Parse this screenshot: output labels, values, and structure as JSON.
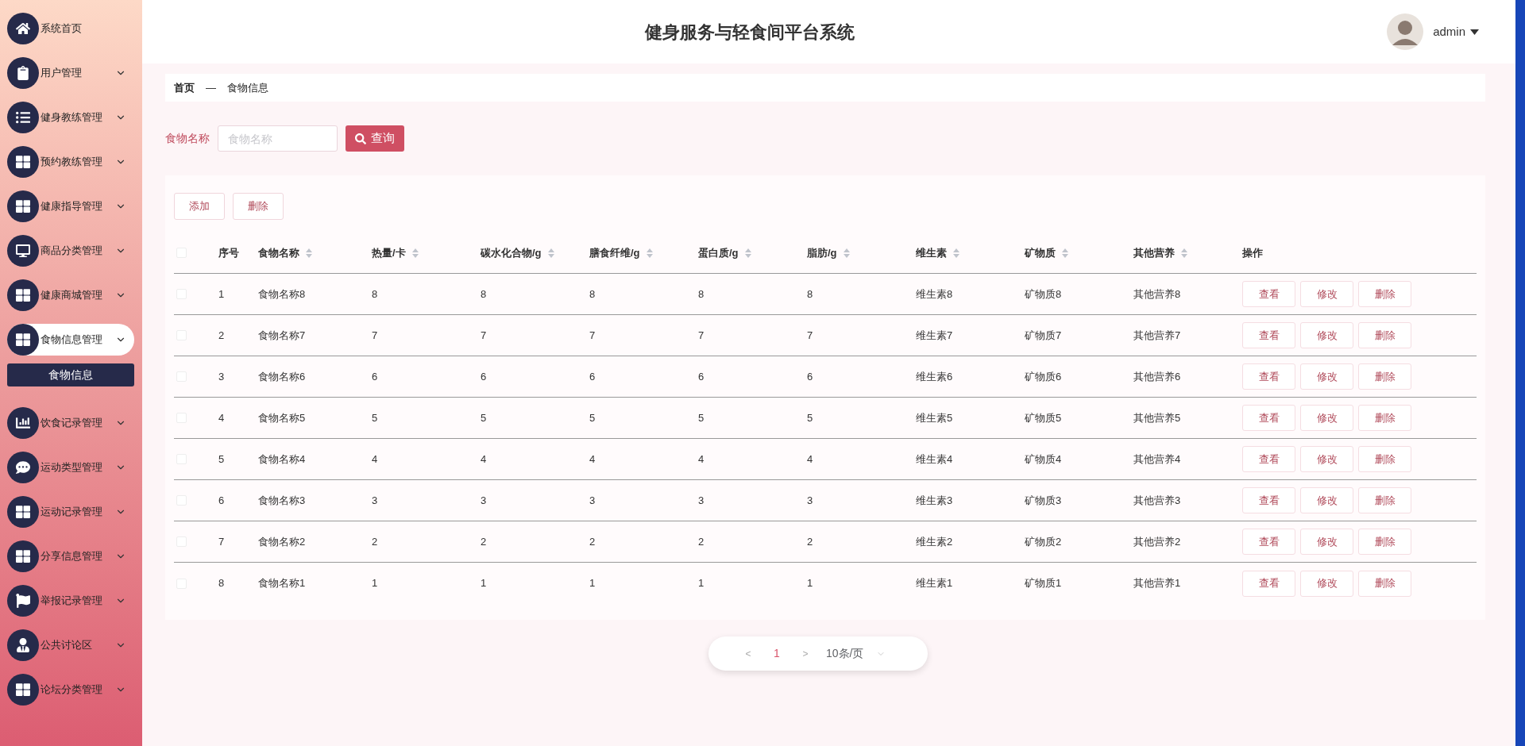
{
  "sidebar": {
    "items": [
      {
        "label": "系统首页",
        "kind": "home",
        "expandable": false,
        "selected": false
      },
      {
        "label": "用户管理",
        "kind": "clipboard",
        "expandable": true,
        "selected": false
      },
      {
        "label": "健身教练管理",
        "kind": "list",
        "expandable": true,
        "selected": false
      },
      {
        "label": "预约教练管理",
        "kind": "grid",
        "expandable": true,
        "selected": false
      },
      {
        "label": "健康指导管理",
        "kind": "grid",
        "expandable": true,
        "selected": false
      },
      {
        "label": "商品分类管理",
        "kind": "monitor",
        "expandable": true,
        "selected": false
      },
      {
        "label": "健康商城管理",
        "kind": "grid",
        "expandable": true,
        "selected": false
      },
      {
        "label": "食物信息管理",
        "kind": "grid",
        "expandable": true,
        "selected": true,
        "children": [
          {
            "label": "食物信息",
            "selected": true
          }
        ]
      },
      {
        "label": "饮食记录管理",
        "kind": "chart",
        "expandable": true,
        "selected": false
      },
      {
        "label": "运动类型管理",
        "kind": "chat",
        "expandable": true,
        "selected": false
      },
      {
        "label": "运动记录管理",
        "kind": "grid",
        "expandable": true,
        "selected": false
      },
      {
        "label": "分享信息管理",
        "kind": "grid",
        "expandable": true,
        "selected": false
      },
      {
        "label": "举报记录管理",
        "kind": "flag",
        "expandable": true,
        "selected": false
      },
      {
        "label": "公共讨论区",
        "kind": "user",
        "expandable": true,
        "selected": false
      },
      {
        "label": "论坛分类管理",
        "kind": "grid",
        "expandable": true,
        "selected": false
      }
    ]
  },
  "header": {
    "title": "健身服务与轻食间平台系统",
    "user": "admin"
  },
  "breadcrumb": [
    "首页",
    "—",
    "食物信息"
  ],
  "search": {
    "label": "食物名称",
    "placeholder": "食物名称",
    "button": "查询"
  },
  "toolbar": [
    "添加",
    "删除"
  ],
  "table": {
    "select_all_checked": false,
    "columns": [
      {
        "label": "序号",
        "sortable": false
      },
      {
        "label": "食物名称",
        "sortable": true
      },
      {
        "label": "热量/卡",
        "sortable": true
      },
      {
        "label": "碳水化合物/g",
        "sortable": true
      },
      {
        "label": "膳食纤维/g",
        "sortable": true
      },
      {
        "label": "蛋白质/g",
        "sortable": true
      },
      {
        "label": "脂肪/g",
        "sortable": true
      },
      {
        "label": "维生素",
        "sortable": true
      },
      {
        "label": "矿物质",
        "sortable": true
      },
      {
        "label": "其他营养",
        "sortable": true
      },
      {
        "label": "操作",
        "sortable": false
      }
    ],
    "rows": [
      {
        "checked": false,
        "cells": [
          "1",
          "食物名称8",
          "8",
          "8",
          "8",
          "8",
          "8",
          "维生素8",
          "矿物质8",
          "其他营养8"
        ],
        "actions": [
          "查看",
          "修改",
          "删除"
        ]
      },
      {
        "checked": false,
        "cells": [
          "2",
          "食物名称7",
          "7",
          "7",
          "7",
          "7",
          "7",
          "维生素7",
          "矿物质7",
          "其他营养7"
        ],
        "actions": [
          "查看",
          "修改",
          "删除"
        ]
      },
      {
        "checked": false,
        "cells": [
          "3",
          "食物名称6",
          "6",
          "6",
          "6",
          "6",
          "6",
          "维生素6",
          "矿物质6",
          "其他营养6"
        ],
        "actions": [
          "查看",
          "修改",
          "删除"
        ]
      },
      {
        "checked": false,
        "cells": [
          "4",
          "食物名称5",
          "5",
          "5",
          "5",
          "5",
          "5",
          "维生素5",
          "矿物质5",
          "其他营养5"
        ],
        "actions": [
          "查看",
          "修改",
          "删除"
        ]
      },
      {
        "checked": false,
        "cells": [
          "5",
          "食物名称4",
          "4",
          "4",
          "4",
          "4",
          "4",
          "维生素4",
          "矿物质4",
          "其他营养4"
        ],
        "actions": [
          "查看",
          "修改",
          "删除"
        ]
      },
      {
        "checked": false,
        "cells": [
          "6",
          "食物名称3",
          "3",
          "3",
          "3",
          "3",
          "3",
          "维生素3",
          "矿物质3",
          "其他营养3"
        ],
        "actions": [
          "查看",
          "修改",
          "删除"
        ]
      },
      {
        "checked": false,
        "cells": [
          "7",
          "食物名称2",
          "2",
          "2",
          "2",
          "2",
          "2",
          "维生素2",
          "矿物质2",
          "其他营养2"
        ],
        "actions": [
          "查看",
          "修改",
          "删除"
        ]
      },
      {
        "checked": false,
        "cells": [
          "8",
          "食物名称1",
          "1",
          "1",
          "1",
          "1",
          "1",
          "维生素1",
          "矿物质1",
          "其他营养1"
        ],
        "actions": [
          "查看",
          "修改",
          "删除"
        ]
      }
    ]
  },
  "pagination": {
    "prev": "<",
    "pages": [
      {
        "label": "1",
        "selected": true
      }
    ],
    "next": ">",
    "page_size": "10条/页"
  }
}
